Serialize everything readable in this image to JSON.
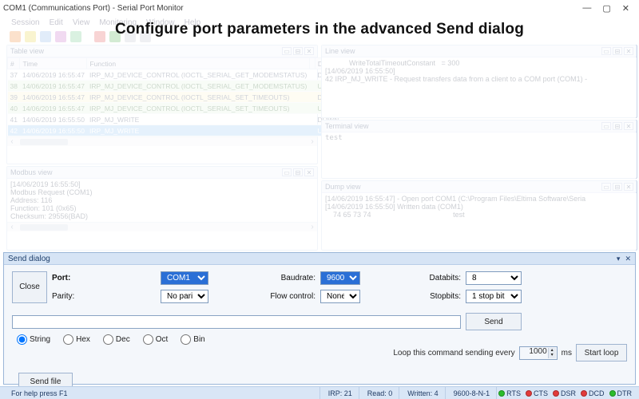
{
  "window": {
    "title": "COM1 (Communications Port) - Serial Port Monitor",
    "controls": {
      "min": "—",
      "max": "▢",
      "close": "✕"
    }
  },
  "banner": "Configure port parameters in the advanced Send dialog",
  "menu": [
    "Session",
    "Edit",
    "View",
    "Monitoring",
    "Window",
    "Help"
  ],
  "panels": {
    "table_view": {
      "title": "Table view",
      "columns": [
        "#",
        "Time",
        "Function",
        "",
        "Direct…"
      ],
      "rows": [
        {
          "n": "37",
          "time": "14/06/2019 16:55:47",
          "fn": "IRP_MJ_DEVICE_CONTROL (IOCTL_SERIAL_GET_MODEMSTATUS)",
          "dir": "DOWN",
          "cls": ""
        },
        {
          "n": "38",
          "time": "14/06/2019 16:55:47",
          "fn": "IRP_MJ_DEVICE_CONTROL (IOCTL_SERIAL_GET_MODEMSTATUS)",
          "dir": "UP",
          "cls": "row-green"
        },
        {
          "n": "39",
          "time": "14/06/2019 16:55:47",
          "fn": "IRP_MJ_DEVICE_CONTROL (IOCTL_SERIAL_SET_TIMEOUTS)",
          "dir": "DOWN",
          "cls": "row-yellow"
        },
        {
          "n": "40",
          "time": "14/06/2019 16:55:47",
          "fn": "IRP_MJ_DEVICE_CONTROL (IOCTL_SERIAL_SET_TIMEOUTS)",
          "dir": "UP",
          "cls": "row-green"
        },
        {
          "n": "41",
          "time": "14/06/2019 16:55:50",
          "fn": "IRP_MJ_WRITE",
          "dir": "DOWN",
          "cls": ""
        },
        {
          "n": "42",
          "time": "14/06/2019 16:55:50",
          "fn": "IRP_MJ_WRITE",
          "dir": "UP",
          "cls": "row-sel"
        }
      ]
    },
    "line_view": {
      "title": "Line view",
      "lines": [
        "            WriteTotalTimeoutConstant   = 300",
        "",
        "[14/06/2019 16:55:50]",
        "42 IRP_MJ_WRITE - Request transfers data from a client to a COM port (COM1) -"
      ]
    },
    "terminal_view": {
      "title": "Terminal view",
      "content": "test"
    },
    "modbus_view": {
      "title": "Modbus view",
      "lines": [
        "[14/06/2019 16:55:50]",
        "Modbus Request (COM1)",
        "Address: 116",
        "Function: 101 (0x65)",
        "Checksum: 29556(BAD)"
      ]
    },
    "dump_view": {
      "title": "Dump view",
      "lines": [
        "[14/06/2019 16:55:47] - Open port COM1 (C:\\Program Files\\Eltima Software\\Seria",
        "",
        "[14/06/2019 16:55:50] Written data (COM1)",
        "    74 65 73 74                                         test"
      ]
    }
  },
  "send_dialog": {
    "title": "Send dialog",
    "labels": {
      "port": "Port:",
      "parity": "Parity:",
      "baudrate": "Baudrate:",
      "flow": "Flow control:",
      "databits": "Databits:",
      "stopbits": "Stopbits:"
    },
    "values": {
      "port": "COM1",
      "parity": "No parity",
      "baudrate": "9600",
      "flow": "None",
      "databits": "8",
      "stopbits": "1 stop bit"
    },
    "radios": [
      "String",
      "Hex",
      "Dec",
      "Oct",
      "Bin"
    ],
    "radio_selected": "String",
    "buttons": {
      "close": "Close",
      "send": "Send",
      "send_file": "Send file",
      "start_loop": "Start loop"
    },
    "loop": {
      "label": "Loop this command sending every",
      "value": "1000",
      "unit": "ms"
    }
  },
  "status": {
    "help": "For help press F1",
    "irp": "IRP: 21",
    "read": "Read: 0",
    "written": "Written: 4",
    "params": "9600-8-N-1",
    "signals": [
      {
        "name": "RTS",
        "color": "g"
      },
      {
        "name": "CTS",
        "color": "r"
      },
      {
        "name": "DSR",
        "color": "r"
      },
      {
        "name": "DCD",
        "color": "r"
      },
      {
        "name": "DTR",
        "color": "g"
      }
    ]
  }
}
